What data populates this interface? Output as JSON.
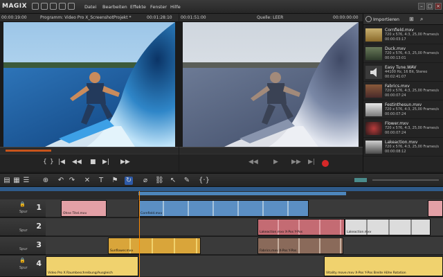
{
  "app": {
    "logo": "MAGIX"
  },
  "menu": [
    "Datei",
    "Bearbeiten",
    "Effekte",
    "Fenster",
    "Hilfe"
  ],
  "program_monitor": {
    "timecode_left": "00:00:19:00",
    "title": "Programm: Video Pro X_ScreenshotProjekt *",
    "timecode_right": "00:01:28:10"
  },
  "source_monitor": {
    "timecode_left": "00:01:51:00",
    "title": "Quelle: LEER",
    "timecode_right": "00:00:00:00"
  },
  "import_panel": {
    "title": "Importieren",
    "items": [
      {
        "name": "Cornfield.mxv",
        "info": "720 x 576, 4:3, 25,00 Frames/s",
        "duration": "00:00:03:17"
      },
      {
        "name": "Duck.mxv",
        "info": "720 x 576, 4:3, 25,00 Frames/s",
        "duration": "00:00:13:01"
      },
      {
        "name": "Easy Tune.WAV",
        "info": "44100 Hz, 16 Bit, Stereo",
        "duration": "00:02:41:07"
      },
      {
        "name": "Fabrics.mxv",
        "info": "720 x 576, 4:3, 25,00 Frames/s",
        "duration": "00:00:07:24"
      },
      {
        "name": "Festinthesun.mxv",
        "info": "720 x 576, 4:3, 25,00 Frames/s",
        "duration": "00:00:07:24"
      },
      {
        "name": "Flower.mxv",
        "info": "720 x 576, 4:3, 25,00 Frames/s",
        "duration": "00:00:07:24"
      },
      {
        "name": "Lakeaction.mxv",
        "info": "720 x 576, 4:3, 25,00 Frames/s",
        "duration": "00:00:08:12"
      }
    ]
  },
  "tracks": [
    {
      "number": "1",
      "label": "Spur"
    },
    {
      "number": "2",
      "label": "Spur"
    },
    {
      "number": "3",
      "label": "Spur"
    },
    {
      "number": "4",
      "label": "Spur"
    }
  ],
  "clips": {
    "t1a": "Ohne Titel.mxv",
    "t1b": "Cornfield.mxv",
    "t2a": "Lakeaction.mxv  X-Pos  Y-Pos",
    "t2b": "Lakeaction.mxv",
    "t3a": "Sunflower.mxv",
    "t3b": "Fabrics.mxv  X-Pos  Y-Pos",
    "t4a": "Video Pro X  Raumbeschreibung/Ausgleich",
    "t4b": "Vitality move.mxv  X-Pos  Y-Pos  Breite  Höhe  Rotation"
  },
  "colors": {
    "accent": "#ff8a00",
    "clip_video": "#a7b8c9",
    "clip_red": "#e3a0a6",
    "clip_audio": "#f0d26e"
  }
}
